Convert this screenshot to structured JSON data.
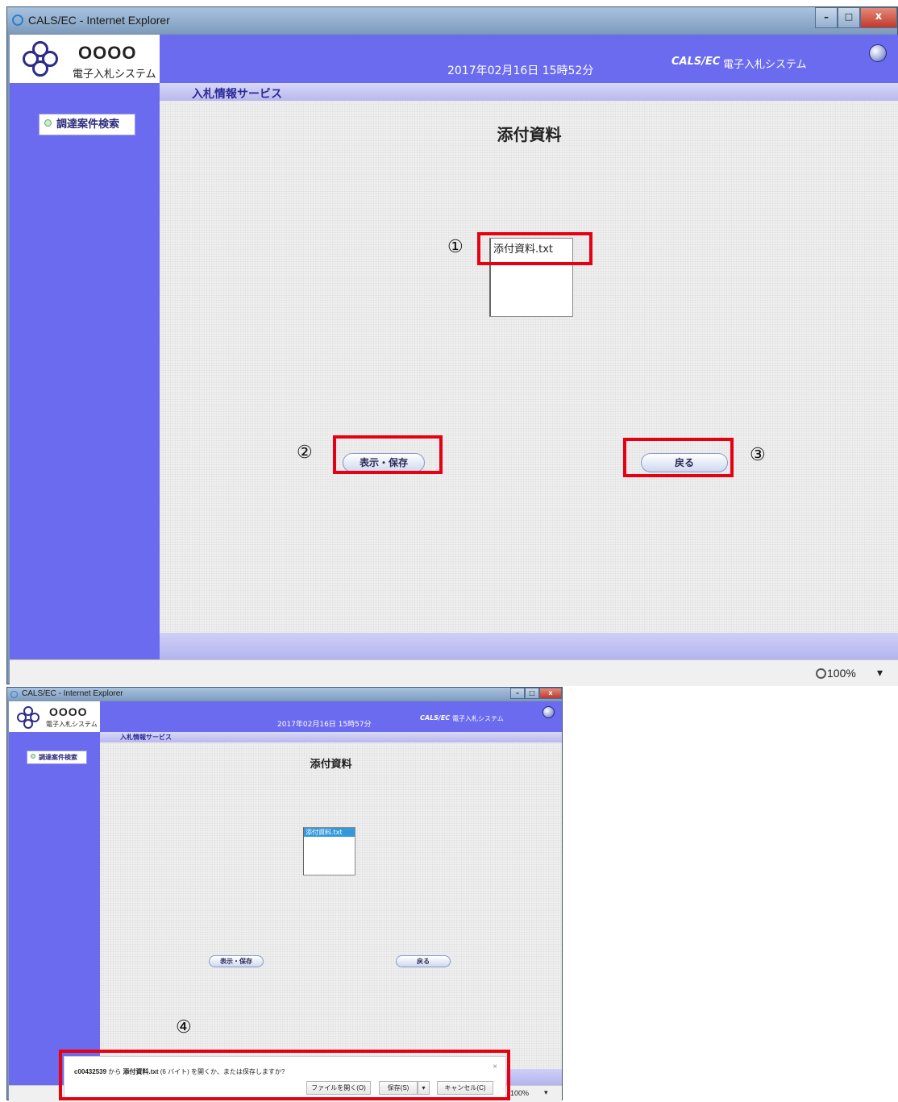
{
  "window1": {
    "title": "CALS/EC - Internet Explorer",
    "datetime": "2017年02月16日 15時52分",
    "system_brand": "CALS/EC",
    "system_name": "電子入札システム",
    "logo_code": "OOOO",
    "logo_name": "電子入札システム",
    "service_bar": "入札情報サービス",
    "sidebar_button": "調達案件検索",
    "page_title": "添付資料",
    "list_items": [
      "添付資料.txt"
    ],
    "buttons": {
      "view_save": "表示・保存",
      "back": "戻る"
    },
    "zoom": "100%"
  },
  "window2": {
    "title": "CALS/EC - Internet Explorer",
    "datetime": "2017年02月16日 15時57分",
    "system_brand": "CALS/EC",
    "system_name": "電子入札システム",
    "logo_code": "OOOO",
    "logo_name": "電子入札システム",
    "service_bar": "入札情報サービス",
    "sidebar_button": "調達案件検索",
    "page_title": "添付資料",
    "list_items": [
      "添付資料.txt"
    ],
    "buttons": {
      "view_save": "表示・保存",
      "back": "戻る"
    },
    "zoom": "100%",
    "download_bar": {
      "source": "c00432539",
      "from_text": "から",
      "filename": "添付資料.txt",
      "size": "(6 バイト)",
      "question": "を開くか、または保存しますか?",
      "open_button": "ファイルを開く(O)",
      "save_button": "保存(S)",
      "cancel_button": "キャンセル(C)",
      "close_glyph": "×"
    }
  },
  "annotations": [
    "①",
    "②",
    "③",
    "④"
  ],
  "window_controls": {
    "minimize": "–",
    "maximize": "□",
    "close": "x",
    "dropdown": "▾"
  },
  "colors": {
    "accent_red": "#e60012",
    "nav_blue": "#6b6bf0"
  }
}
